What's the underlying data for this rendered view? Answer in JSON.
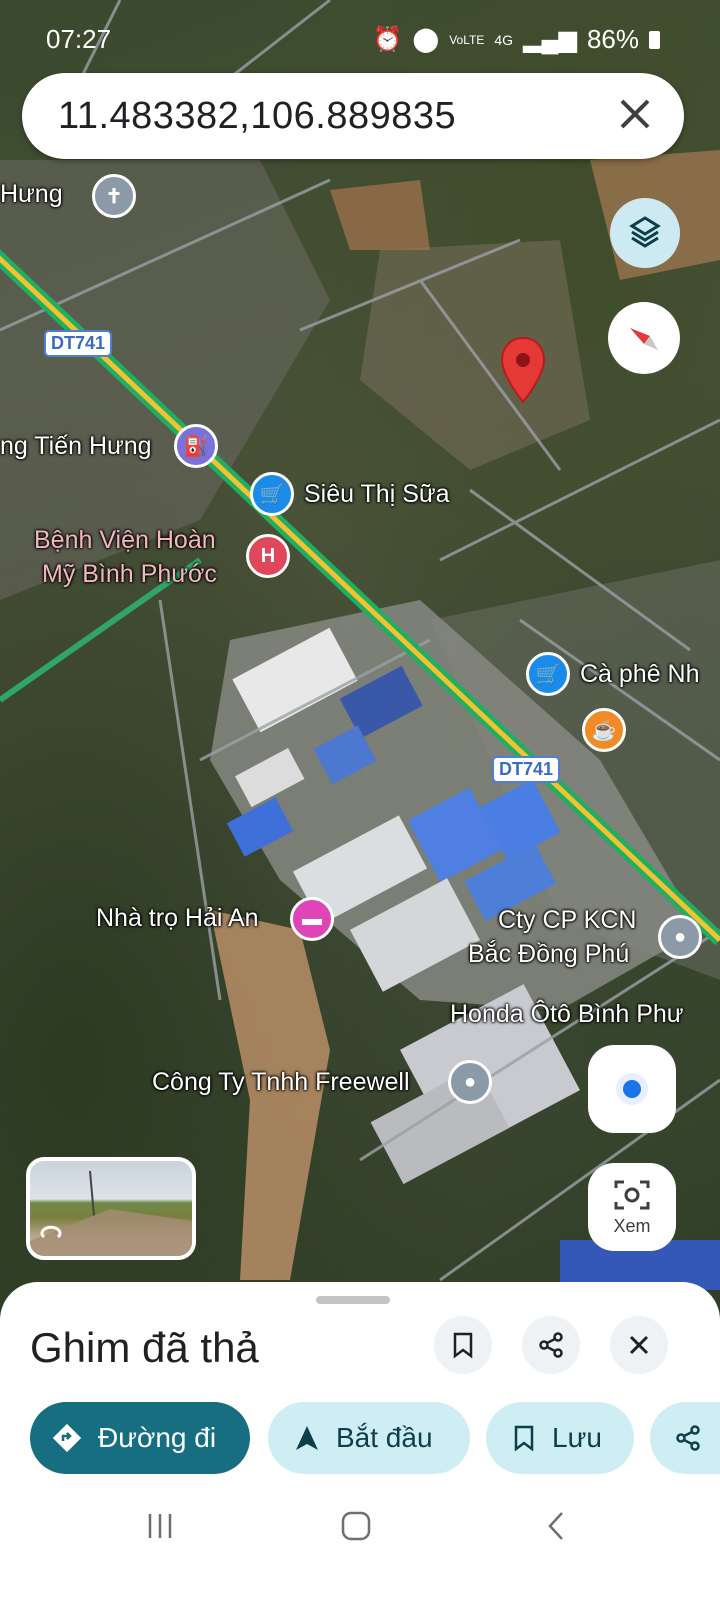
{
  "status_bar": {
    "time": "07:27",
    "network": "4G",
    "volte": "VoLTE",
    "battery": "86%"
  },
  "search": {
    "query": "11.483382,106.889835"
  },
  "map": {
    "road_labels": [
      "DT741",
      "DT741"
    ],
    "places": [
      {
        "name": "Hưng",
        "type": "church"
      },
      {
        "name": "ng Tiến Hưng",
        "type": "gas-station"
      },
      {
        "name": "Siêu Thị Sữa",
        "type": "shopping"
      },
      {
        "name_line1": "Bệnh Viện Hoàn",
        "name_line2": "Mỹ Bình Phước",
        "type": "hospital"
      },
      {
        "name": "Cà phê Nh",
        "type": "shopping"
      },
      {
        "name": "",
        "type": "cafe"
      },
      {
        "name": "Nhà trọ Hải An",
        "type": "lodging"
      },
      {
        "name_line1": "Cty CP KCN",
        "name_line2": "Bắc Đồng Phú",
        "type": "place"
      },
      {
        "name": "Honda Ôtô Bình Phư",
        "type": "label"
      },
      {
        "name": "Công Ty Tnhh Freewell",
        "type": "place"
      }
    ],
    "accent": "#e53935"
  },
  "controls": {
    "view_label": "Xem"
  },
  "sheet": {
    "title": "Ghim đã thả",
    "chips": [
      {
        "label": "Đường đi",
        "icon": "directions-icon"
      },
      {
        "label": "Bắt đầu",
        "icon": "navigation-arrow-icon"
      },
      {
        "label": "Lưu",
        "icon": "bookmark-icon"
      },
      {
        "label": "",
        "icon": "share-icon"
      }
    ]
  },
  "colors": {
    "primary_chip": "#176e80",
    "secondary_chip": "#cfeef4"
  }
}
